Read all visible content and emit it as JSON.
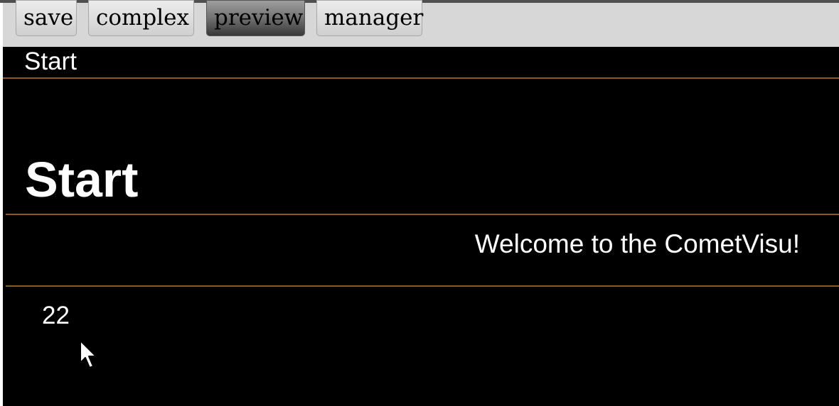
{
  "toolbar": {
    "save_label": "save",
    "complex_label": "complex",
    "preview_label": "preview",
    "manager_label": "manager",
    "active_button": "preview"
  },
  "breadcrumb": {
    "label": "Start"
  },
  "page": {
    "title": "Start",
    "welcome_text": "Welcome to the CometVisu!",
    "value_text": "22"
  },
  "colors": {
    "background": "#000000",
    "text": "#ffffff",
    "separator": "#8c5a24",
    "toolbar": "#d7d7d7"
  },
  "icons": {
    "cursor": "mouse-pointer-icon"
  }
}
